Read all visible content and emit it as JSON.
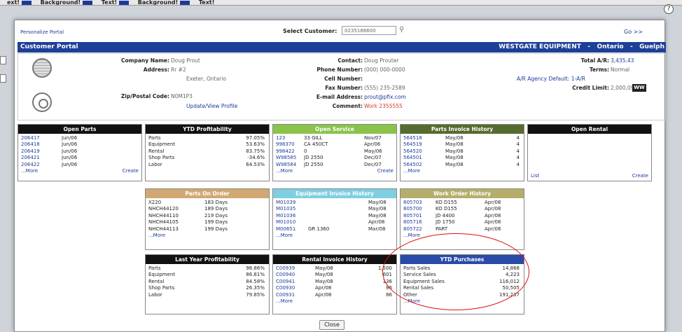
{
  "topbar": {
    "items": [
      "ext!",
      "Background!",
      "Text!",
      "Background!",
      "Text!"
    ]
  },
  "help_glyph": "?",
  "header": {
    "personalize": "Personalize Portal",
    "select_label": "Select Customer:",
    "customer_value": "0235186600",
    "go": "Go >>"
  },
  "banner": {
    "title": "Customer Portal",
    "company": "WESTGATE EQUIPMENT",
    "sep1": "-",
    "region": "Ontario",
    "sep2": "-",
    "city": "Guelph"
  },
  "info": {
    "company_label": "Company Name:",
    "company": "Doug Prout",
    "address_label": "Address:",
    "address1": "Rr #2",
    "address2": "Exeter, Ontario",
    "zip_label": "Zip/Postal Code:",
    "zip": "N0M1P3",
    "update": "Update/View Profile",
    "contact_label": "Contact:",
    "contact": "Doug Prouter",
    "phone_label": "Phone Number:",
    "phone": "(000) 000-0000",
    "cell_label": "Cell Number:",
    "cell": "",
    "fax_label": "Fax Number:",
    "fax": "(555) 235-2589",
    "email_label": "E-mail Address:",
    "email": "prout@pfix.com",
    "comment_label": "Comment:",
    "comment": "Work 2355555",
    "total_label": "Total A/R:",
    "total": "3,435.43",
    "terms_label": "Terms:",
    "terms": "Normal",
    "agency": "A/R Agency Default: 1-A/R",
    "credit_label": "Credit Limit:",
    "credit": "2,000,099",
    "ww": "WW"
  },
  "panels": {
    "open_parts": {
      "title": "Open Parts",
      "rows": [
        [
          "206417",
          "Jun/06"
        ],
        [
          "206418",
          "Jun/06"
        ],
        [
          "206419",
          "Jun/06"
        ],
        [
          "206421",
          "Jun/06"
        ],
        [
          "206422",
          "Jun/06"
        ]
      ],
      "more": "...More",
      "create": "Create",
      "color": "#111111"
    },
    "ytd_profit": {
      "title": "YTD Profitability",
      "rows": [
        [
          "Parts",
          "97.05%"
        ],
        [
          "Equipment",
          "53.63%"
        ],
        [
          "Rental",
          "83.75%"
        ],
        [
          "Shop Parts",
          "-34.6%"
        ],
        [
          "Labor",
          "64.53%"
        ]
      ],
      "color": "#111111"
    },
    "open_service": {
      "title": "Open Service",
      "rows": [
        [
          "123",
          "33 GILL",
          "Nov/07"
        ],
        [
          "998370",
          "CA 450CT",
          "Apr/06"
        ],
        [
          "998422",
          "0",
          "May/06"
        ],
        [
          "W98585",
          "JD 2550",
          "Dec/07"
        ],
        [
          "W98584",
          "JD 2550",
          "Dec/07"
        ]
      ],
      "more": "...More",
      "create": "Create",
      "color": "#8bc34a"
    },
    "parts_invoice": {
      "title": "Parts Invoice History",
      "rows": [
        [
          "564518",
          "May/08",
          "4"
        ],
        [
          "564519",
          "May/08",
          "4"
        ],
        [
          "564520",
          "May/08",
          "4"
        ],
        [
          "564501",
          "May/08",
          "4"
        ],
        [
          "564502",
          "May/08",
          "4"
        ]
      ],
      "more": "...More",
      "color": "#556b2f"
    },
    "open_rental": {
      "title": "Open Rental",
      "list": "List",
      "create": "Create",
      "color": "#111111"
    },
    "parts_on_order": {
      "title": "Parts On Order",
      "rows": [
        [
          "X220",
          "183 Days"
        ],
        [
          "NHCH44120",
          "189 Days"
        ],
        [
          "NHCH44110",
          "219 Days"
        ],
        [
          "NHCH44105",
          "199 Days"
        ],
        [
          "NHCH44113",
          "199 Days"
        ]
      ],
      "more": "...More",
      "color": "#d2a872"
    },
    "equip_invoice": {
      "title": "Equipment Invoice History",
      "rows": [
        [
          "M01039",
          "",
          "May/08"
        ],
        [
          "M01035",
          "",
          "May/08"
        ],
        [
          "M01036",
          "",
          "May/08"
        ],
        [
          "M01010",
          "",
          "Apr/08"
        ],
        [
          "M00651",
          "GR 1360",
          "Mar/08"
        ]
      ],
      "more": "...More",
      "color": "#7ecfe0"
    },
    "work_order": {
      "title": "Work Order History",
      "rows": [
        [
          "805703",
          "KO D155",
          "Apr/08"
        ],
        [
          "805700",
          "KO D155",
          "Apr/08"
        ],
        [
          "805701",
          "JD 4400",
          "Apr/08"
        ],
        [
          "805716",
          "JD 1750",
          "Apr/08"
        ],
        [
          "805722",
          "PART",
          "Apr/08"
        ]
      ],
      "more": "...More",
      "color": "#b5ae6a"
    },
    "last_year": {
      "title": "Last Year Profitability",
      "rows": [
        [
          "Parts",
          "98.86%"
        ],
        [
          "Equipment",
          "86.81%"
        ],
        [
          "Rental",
          "84.58%"
        ],
        [
          "Shop Parts",
          "26.35%"
        ],
        [
          "Labor",
          "79.85%"
        ]
      ],
      "color": "#111111"
    },
    "rental_invoice": {
      "title": "Rental Invoice History",
      "rows": [
        [
          "C00939",
          "May/08",
          "1,500"
        ],
        [
          "C00940",
          "May/08",
          "601"
        ],
        [
          "C00941",
          "May/08",
          "136"
        ],
        [
          "C00930",
          "Apr/08",
          "86"
        ],
        [
          "C00931",
          "Apr/08",
          "86"
        ]
      ],
      "more": "...More",
      "color": "#111111"
    },
    "ytd_purchases": {
      "title": "YTD Purchases",
      "rows": [
        [
          "Parts Sales",
          "14,868"
        ],
        [
          "Service Sales",
          "4,223"
        ],
        [
          "Equipment Sales",
          "116,012"
        ],
        [
          "Rental Sales",
          "50,505"
        ],
        [
          "Other",
          "191,237"
        ]
      ],
      "more": "...More",
      "color": "#2a4aa8"
    }
  },
  "close": "Close"
}
